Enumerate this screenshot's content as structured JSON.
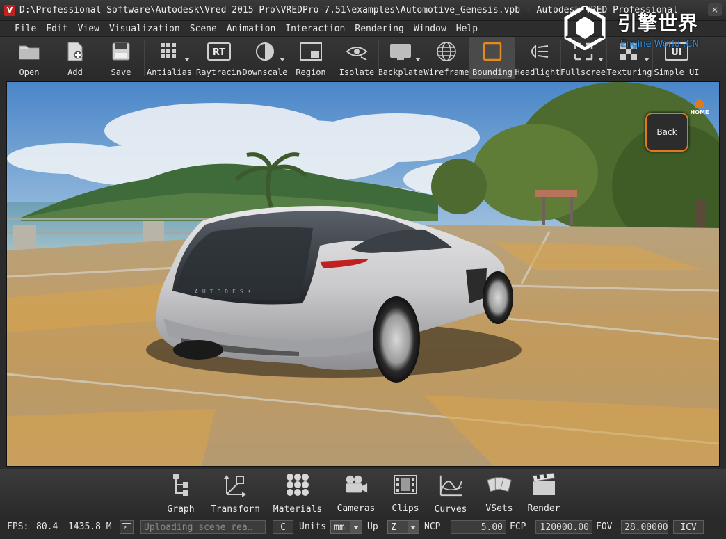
{
  "window": {
    "title": "D:\\Professional Software\\Autodesk\\Vred 2015 Pro\\VREDPro-7.51\\examples\\Automotive_Genesis.vpb - Autodesk VRED Professional",
    "app_icon_letter": "V",
    "close_glyph": "×"
  },
  "menu": [
    "File",
    "Edit",
    "View",
    "Visualization",
    "Scene",
    "Animation",
    "Interaction",
    "Rendering",
    "Window",
    "Help"
  ],
  "logo": {
    "cn_text": "引擎世界",
    "en_text": "Engine World .CN"
  },
  "toolbar": [
    {
      "label": "Open",
      "icon": "folder-icon"
    },
    {
      "label": "Add",
      "icon": "add-file-icon"
    },
    {
      "label": "Save",
      "icon": "save-icon"
    },
    {
      "label": "Antialiasing",
      "icon": "antialiasing-icon",
      "dropdown": true
    },
    {
      "label": "Raytracing",
      "icon": "raytracing-icon",
      "badge": "RT"
    },
    {
      "label": "Downscale",
      "icon": "downscale-icon",
      "dropdown": true
    },
    {
      "label": "Region",
      "icon": "region-icon"
    },
    {
      "label": "Isolate",
      "icon": "isolate-icon"
    },
    {
      "label": "Backplate",
      "icon": "backplate-icon",
      "dropdown": true
    },
    {
      "label": "Wireframe",
      "icon": "wireframe-icon"
    },
    {
      "label": "Bounding",
      "icon": "bounding-box-icon",
      "active": true
    },
    {
      "label": "Headlight",
      "icon": "headlight-icon"
    },
    {
      "label": "Fullscreen",
      "icon": "fullscreen-icon",
      "dropdown": true
    },
    {
      "label": "Texturing",
      "icon": "texturing-icon",
      "dropdown": true
    },
    {
      "label": "Simple UI",
      "icon": "simple-ui-icon",
      "badge": "UI"
    }
  ],
  "viewport": {
    "home_label": "HOME",
    "back_label": "Back",
    "plate_text": "AUTODESK"
  },
  "modules": [
    {
      "label": "Graph",
      "icon": "graph-icon"
    },
    {
      "label": "Transform",
      "icon": "transform-icon"
    },
    {
      "label": "Materials",
      "icon": "materials-icon"
    },
    {
      "label": "Cameras",
      "icon": "cameras-icon"
    },
    {
      "label": "Clips",
      "icon": "clips-icon"
    },
    {
      "label": "Curves",
      "icon": "curves-icon"
    },
    {
      "label": "VSets",
      "icon": "vsets-icon"
    },
    {
      "label": "Render",
      "icon": "render-icon"
    }
  ],
  "status": {
    "fps_label": "FPS:",
    "fps_value": "80.4",
    "memory": "1435.8 M",
    "message_placeholder": "Uploading scene rea…",
    "c_button": "C",
    "units_label": "Units",
    "units_value": "mm",
    "up_label": "Up",
    "up_value": "Z",
    "ncp_label": "NCP",
    "ncp_value": "5.00",
    "fcp_label": "FCP",
    "fcp_value": "120000.00",
    "fov_label": "FOV",
    "fov_value": "28.00000",
    "icv_button": "ICV"
  }
}
